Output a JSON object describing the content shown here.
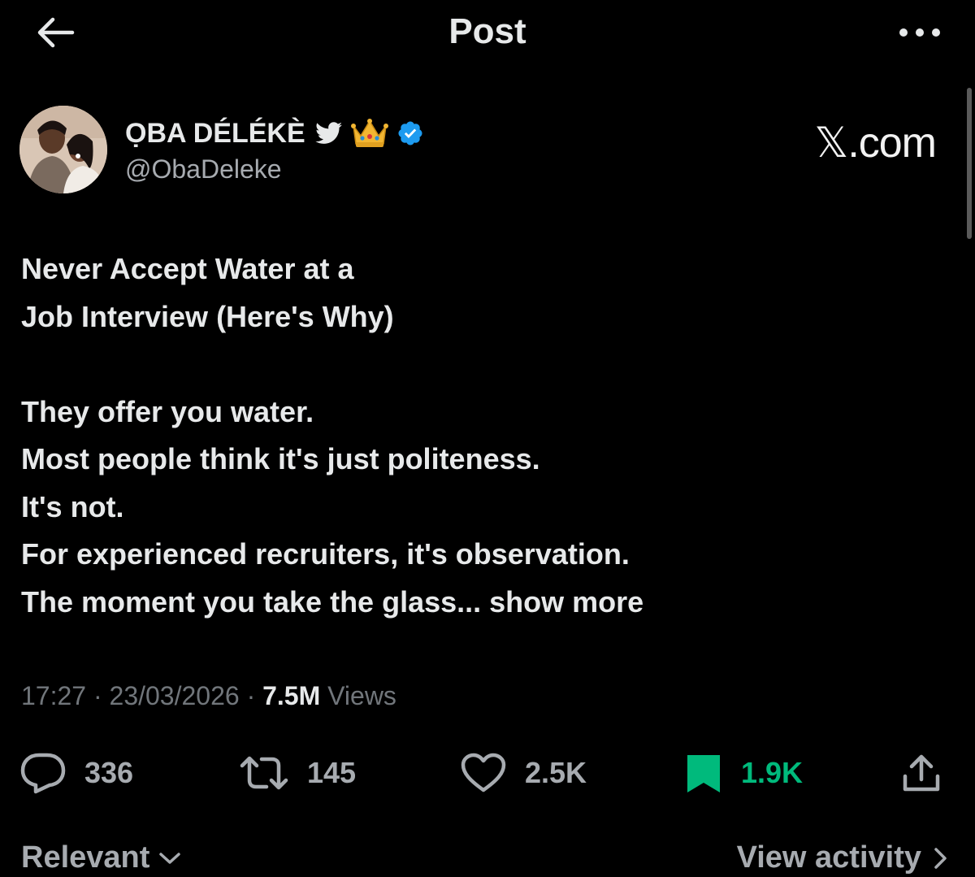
{
  "header": {
    "title": "Post",
    "back_icon": "arrow-left-icon",
    "more_icon": "more-horizontal-icon"
  },
  "author": {
    "display_name": "ỌBA DÉLÉKÈ",
    "handle": "@ObaDeleke",
    "badges": [
      "bird-icon",
      "crown-icon",
      "verified-icon"
    ],
    "verified_color": "#1d9bf0"
  },
  "watermark": "𝕏.com",
  "post": {
    "title_lines": [
      "Never Accept Water at a",
      "Job Interview (Here's Why)"
    ],
    "body_lines": [
      "They offer you water.",
      "Most people think it's just politeness.",
      "It's not.",
      "For experienced recruiters, it's observation."
    ],
    "last_line": "The moment you take the glass...",
    "show_more": "show more"
  },
  "meta": {
    "time": "17:27",
    "date": "23/03/2026",
    "views_count": "7.5M",
    "views_label": "Views",
    "separator": "·"
  },
  "actions": {
    "replies": "336",
    "reposts": "145",
    "likes": "2.5K",
    "bookmarks": "1.9K",
    "bookmark_active_color": "#00ba7c"
  },
  "footer": {
    "sort_label": "Relevant",
    "view_activity": "View activity"
  }
}
